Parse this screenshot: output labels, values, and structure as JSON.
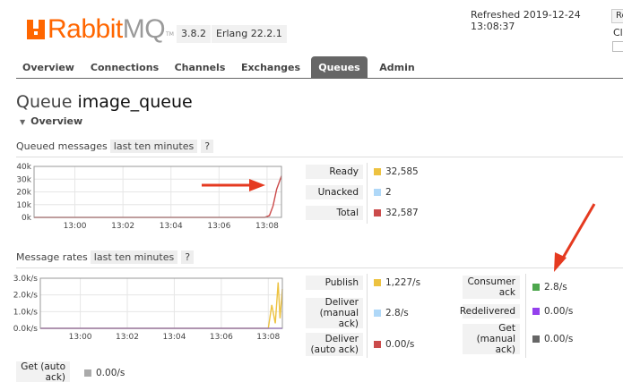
{
  "header": {
    "logo_rabbit": "Rabbit",
    "logo_mq": "MQ",
    "logo_tm": "TM",
    "version": "3.8.2",
    "erlang": "Erlang 22.2.1",
    "refreshed": "Refreshed 2019-12-24 13:08:37",
    "refresh_button": "Re",
    "cluster_label": "Cl"
  },
  "nav": {
    "tabs": [
      {
        "label": "Overview"
      },
      {
        "label": "Connections"
      },
      {
        "label": "Channels"
      },
      {
        "label": "Exchanges"
      },
      {
        "label": "Queues",
        "active": true
      },
      {
        "label": "Admin"
      }
    ]
  },
  "page": {
    "title_prefix": "Queue",
    "queue_name": "image_queue",
    "section": "Overview"
  },
  "queued": {
    "heading": "Queued messages",
    "range": "last ten minutes",
    "help": "?",
    "stats": [
      {
        "label": "Ready",
        "value": "32,585",
        "color": "#edc240"
      },
      {
        "label": "Unacked",
        "value": "2",
        "color": "#afd8f8"
      },
      {
        "label": "Total",
        "value": "32,587",
        "color": "#cb4b4b"
      }
    ]
  },
  "rates": {
    "heading": "Message rates",
    "range": "last ten minutes",
    "help": "?",
    "col1": [
      {
        "label": "Publish",
        "value": "1,227/s",
        "color": "#edc240"
      },
      {
        "label": "Deliver (manual ack)",
        "value": "2.8/s",
        "color": "#afd8f8"
      },
      {
        "label": "Deliver (auto ack)",
        "value": "0.00/s",
        "color": "#cb4b4b"
      },
      {
        "label": "Get (auto ack)",
        "value": "0.00/s",
        "color": "#aaaaaa"
      }
    ],
    "col2": [
      {
        "label": "Consumer ack",
        "value": "2.8/s",
        "color": "#4da74d"
      },
      {
        "label": "Redelivered",
        "value": "0.00/s",
        "color": "#9440ed"
      },
      {
        "label": "Get (manual ack)",
        "value": "0.00/s",
        "color": "#666666"
      }
    ]
  },
  "chart_data": [
    {
      "type": "line",
      "x_ticks": [
        "13:00",
        "13:02",
        "13:04",
        "13:06",
        "13:08"
      ],
      "y_ticks": [
        "0k",
        "10k",
        "20k",
        "30k",
        "40k"
      ],
      "ylim": [
        0,
        40000
      ],
      "x_range_minutes": [
        -1.7,
        8.6
      ],
      "series": [
        {
          "name": "Total",
          "color": "#cb4b4b",
          "points": [
            [
              -1.7,
              0
            ],
            [
              7.9,
              0
            ],
            [
              8.1,
              1500
            ],
            [
              8.25,
              9000
            ],
            [
              8.4,
              22000
            ],
            [
              8.6,
              32587
            ]
          ]
        }
      ]
    },
    {
      "type": "line",
      "x_ticks": [
        "13:00",
        "13:02",
        "13:04",
        "13:06",
        "13:08"
      ],
      "y_ticks": [
        "0.0k/s",
        "1.0k/s",
        "2.0k/s",
        "3.0k/s"
      ],
      "ylim": [
        0,
        3000
      ],
      "x_range_minutes": [
        -1.7,
        8.6
      ],
      "series": [
        {
          "name": "Publish",
          "color": "#edc240",
          "points": [
            [
              -1.7,
              0
            ],
            [
              8.0,
              0
            ],
            [
              8.15,
              1400
            ],
            [
              8.3,
              300
            ],
            [
              8.42,
              2750
            ],
            [
              8.5,
              600
            ],
            [
              8.6,
              2350
            ]
          ]
        },
        {
          "name": "Redelivered",
          "color": "#9440ed",
          "points": [
            [
              -1.7,
              0
            ],
            [
              8.6,
              0
            ]
          ]
        }
      ]
    }
  ]
}
